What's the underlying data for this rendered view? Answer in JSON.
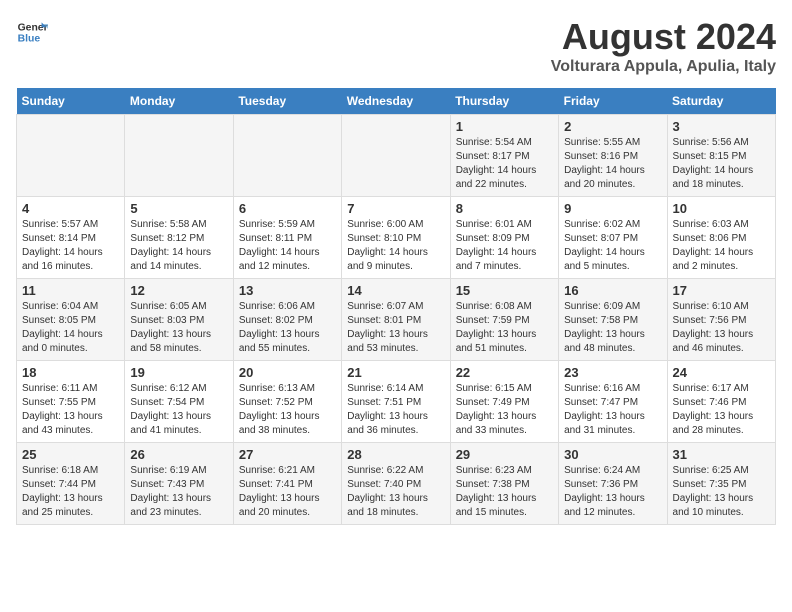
{
  "header": {
    "logo_line1": "General",
    "logo_line2": "Blue",
    "month_title": "August 2024",
    "subtitle": "Volturara Appula, Apulia, Italy"
  },
  "weekdays": [
    "Sunday",
    "Monday",
    "Tuesday",
    "Wednesday",
    "Thursday",
    "Friday",
    "Saturday"
  ],
  "weeks": [
    [
      {
        "day": "",
        "info": ""
      },
      {
        "day": "",
        "info": ""
      },
      {
        "day": "",
        "info": ""
      },
      {
        "day": "",
        "info": ""
      },
      {
        "day": "1",
        "info": "Sunrise: 5:54 AM\nSunset: 8:17 PM\nDaylight: 14 hours\nand 22 minutes."
      },
      {
        "day": "2",
        "info": "Sunrise: 5:55 AM\nSunset: 8:16 PM\nDaylight: 14 hours\nand 20 minutes."
      },
      {
        "day": "3",
        "info": "Sunrise: 5:56 AM\nSunset: 8:15 PM\nDaylight: 14 hours\nand 18 minutes."
      }
    ],
    [
      {
        "day": "4",
        "info": "Sunrise: 5:57 AM\nSunset: 8:14 PM\nDaylight: 14 hours\nand 16 minutes."
      },
      {
        "day": "5",
        "info": "Sunrise: 5:58 AM\nSunset: 8:12 PM\nDaylight: 14 hours\nand 14 minutes."
      },
      {
        "day": "6",
        "info": "Sunrise: 5:59 AM\nSunset: 8:11 PM\nDaylight: 14 hours\nand 12 minutes."
      },
      {
        "day": "7",
        "info": "Sunrise: 6:00 AM\nSunset: 8:10 PM\nDaylight: 14 hours\nand 9 minutes."
      },
      {
        "day": "8",
        "info": "Sunrise: 6:01 AM\nSunset: 8:09 PM\nDaylight: 14 hours\nand 7 minutes."
      },
      {
        "day": "9",
        "info": "Sunrise: 6:02 AM\nSunset: 8:07 PM\nDaylight: 14 hours\nand 5 minutes."
      },
      {
        "day": "10",
        "info": "Sunrise: 6:03 AM\nSunset: 8:06 PM\nDaylight: 14 hours\nand 2 minutes."
      }
    ],
    [
      {
        "day": "11",
        "info": "Sunrise: 6:04 AM\nSunset: 8:05 PM\nDaylight: 14 hours\nand 0 minutes."
      },
      {
        "day": "12",
        "info": "Sunrise: 6:05 AM\nSunset: 8:03 PM\nDaylight: 13 hours\nand 58 minutes."
      },
      {
        "day": "13",
        "info": "Sunrise: 6:06 AM\nSunset: 8:02 PM\nDaylight: 13 hours\nand 55 minutes."
      },
      {
        "day": "14",
        "info": "Sunrise: 6:07 AM\nSunset: 8:01 PM\nDaylight: 13 hours\nand 53 minutes."
      },
      {
        "day": "15",
        "info": "Sunrise: 6:08 AM\nSunset: 7:59 PM\nDaylight: 13 hours\nand 51 minutes."
      },
      {
        "day": "16",
        "info": "Sunrise: 6:09 AM\nSunset: 7:58 PM\nDaylight: 13 hours\nand 48 minutes."
      },
      {
        "day": "17",
        "info": "Sunrise: 6:10 AM\nSunset: 7:56 PM\nDaylight: 13 hours\nand 46 minutes."
      }
    ],
    [
      {
        "day": "18",
        "info": "Sunrise: 6:11 AM\nSunset: 7:55 PM\nDaylight: 13 hours\nand 43 minutes."
      },
      {
        "day": "19",
        "info": "Sunrise: 6:12 AM\nSunset: 7:54 PM\nDaylight: 13 hours\nand 41 minutes."
      },
      {
        "day": "20",
        "info": "Sunrise: 6:13 AM\nSunset: 7:52 PM\nDaylight: 13 hours\nand 38 minutes."
      },
      {
        "day": "21",
        "info": "Sunrise: 6:14 AM\nSunset: 7:51 PM\nDaylight: 13 hours\nand 36 minutes."
      },
      {
        "day": "22",
        "info": "Sunrise: 6:15 AM\nSunset: 7:49 PM\nDaylight: 13 hours\nand 33 minutes."
      },
      {
        "day": "23",
        "info": "Sunrise: 6:16 AM\nSunset: 7:47 PM\nDaylight: 13 hours\nand 31 minutes."
      },
      {
        "day": "24",
        "info": "Sunrise: 6:17 AM\nSunset: 7:46 PM\nDaylight: 13 hours\nand 28 minutes."
      }
    ],
    [
      {
        "day": "25",
        "info": "Sunrise: 6:18 AM\nSunset: 7:44 PM\nDaylight: 13 hours\nand 25 minutes."
      },
      {
        "day": "26",
        "info": "Sunrise: 6:19 AM\nSunset: 7:43 PM\nDaylight: 13 hours\nand 23 minutes."
      },
      {
        "day": "27",
        "info": "Sunrise: 6:21 AM\nSunset: 7:41 PM\nDaylight: 13 hours\nand 20 minutes."
      },
      {
        "day": "28",
        "info": "Sunrise: 6:22 AM\nSunset: 7:40 PM\nDaylight: 13 hours\nand 18 minutes."
      },
      {
        "day": "29",
        "info": "Sunrise: 6:23 AM\nSunset: 7:38 PM\nDaylight: 13 hours\nand 15 minutes."
      },
      {
        "day": "30",
        "info": "Sunrise: 6:24 AM\nSunset: 7:36 PM\nDaylight: 13 hours\nand 12 minutes."
      },
      {
        "day": "31",
        "info": "Sunrise: 6:25 AM\nSunset: 7:35 PM\nDaylight: 13 hours\nand 10 minutes."
      }
    ]
  ]
}
